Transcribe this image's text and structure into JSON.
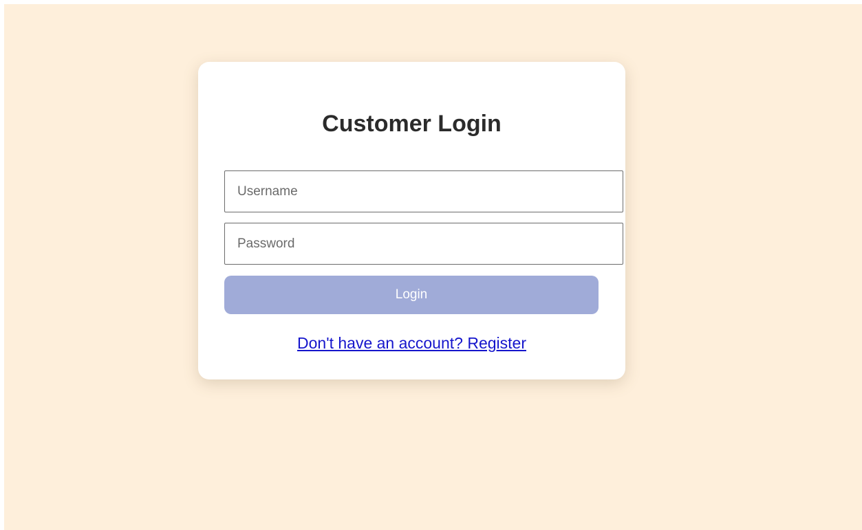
{
  "login_form": {
    "title": "Customer Login",
    "username_placeholder": "Username",
    "username_value": "",
    "password_placeholder": "Password",
    "password_value": "",
    "login_button_label": "Login",
    "register_link_text": "Don't have an account? Register"
  },
  "colors": {
    "page_background": "#feefdb",
    "card_background": "#ffffff",
    "button_background": "#a0abd8",
    "link_color": "#1515cc",
    "title_color": "#2b2b2b"
  }
}
